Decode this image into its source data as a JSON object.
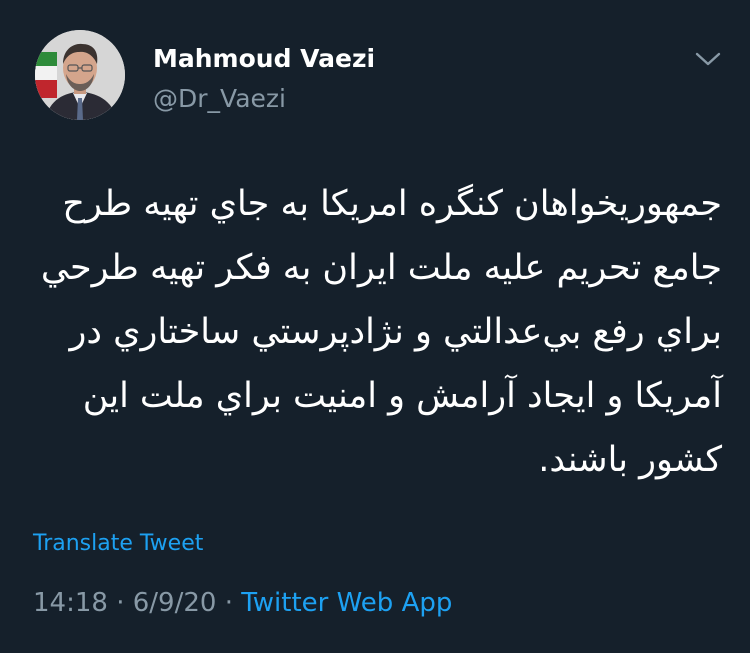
{
  "tweet": {
    "author": {
      "display_name": "Mahmoud Vaezi",
      "handle": "@Dr_Vaezi"
    },
    "text": "جمهوريخواهان کنگره امريکا به جاي تهيه طرح جامع تحريم عليه ملت ايران به فکر تهيه طرحي براي رفع بي‌عدالتي و نژادپرستي ساختاري در آمريکا و ايجاد آرامش و امنيت براي ملت اين کشور باشند.",
    "translate_label": "Translate Tweet",
    "time": "14:18",
    "date": "6/9/20",
    "separator": "·",
    "source": "Twitter Web App"
  },
  "icons": {
    "menu": "chevron-down-icon",
    "avatar": "profile-photo"
  },
  "colors": {
    "background": "#15202b",
    "primary_text": "#ffffff",
    "secondary_text": "#8899a6",
    "accent": "#1da1f2"
  }
}
